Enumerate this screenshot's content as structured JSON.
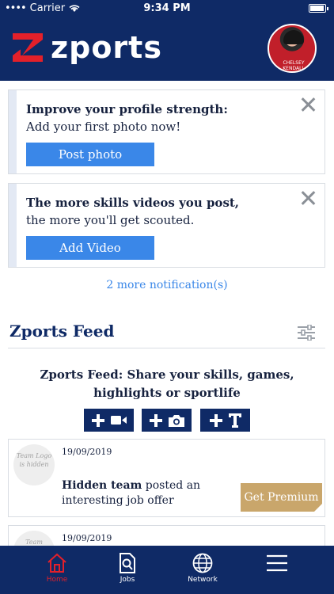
{
  "status_bar": {
    "carrier": "Carrier",
    "time": "9:34 PM",
    "battery_level": 0.85
  },
  "header": {
    "brand": "zports",
    "avatar_caption": "CHELSEY KENDALL"
  },
  "notifications": [
    {
      "title": "Improve your profile strength:",
      "text": "Add your first photo now!",
      "button": "Post photo"
    },
    {
      "title": "The more skills videos you post,",
      "text": "the more you'll get scouted.",
      "button": "Add Video"
    }
  ],
  "more_notifications": "2 more notification(s)",
  "feed": {
    "title": "Zports Feed",
    "share_text": "Zports Feed: Share your skills, games, highlights or sportlife",
    "posts": [
      {
        "logo_text": "Team Logo is hidden",
        "date": "19/09/2019",
        "team": "Hidden team",
        "message": " posted an interesting job offer",
        "cta": "Get Premium"
      },
      {
        "logo_text": "Team",
        "date": "19/09/2019"
      }
    ]
  },
  "nav": [
    {
      "label": "Home",
      "active": true
    },
    {
      "label": "Jobs",
      "active": false
    },
    {
      "label": "Network",
      "active": false
    },
    {
      "label": "",
      "active": false
    }
  ],
  "colors": {
    "navy": "#0f2a66",
    "accent_blue": "#3a87e8",
    "premium_gold": "#c9a66b",
    "brand_red": "#e3202a"
  }
}
